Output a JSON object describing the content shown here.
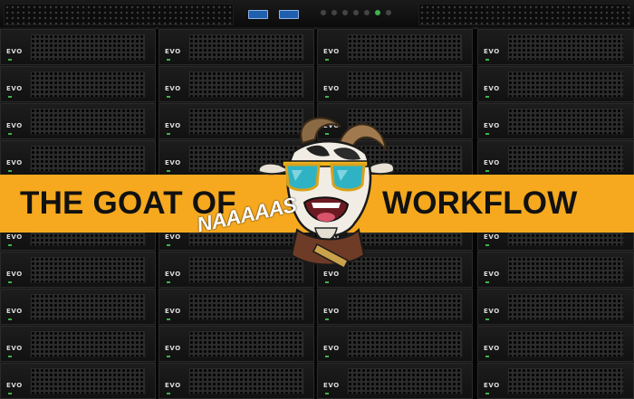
{
  "banner": {
    "left_text": "THE GOAT OF",
    "right_text": "WORKFLOW",
    "color": "#f6a91e"
  },
  "overlay_text": "NAAAAAS",
  "rack": {
    "drive_label": "EVO",
    "columns": 4,
    "rows": 10
  },
  "icons": [
    "goat-mascot-icon",
    "sunglasses-icon",
    "usb-port-icon"
  ]
}
